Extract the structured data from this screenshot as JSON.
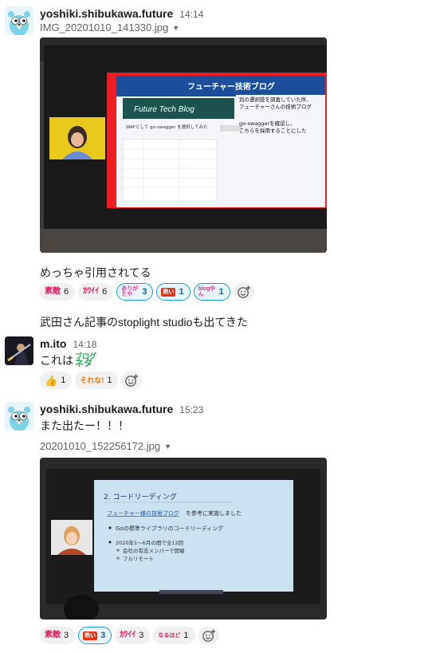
{
  "messages": [
    {
      "username": "yoshiki.shibukawa.future",
      "time": "14:14",
      "filename": "IMG_20201010_141330.jpg",
      "slide": {
        "title": "フューチャー技術ブログ",
        "banner": "Future Tech Blog",
        "heading": "WAFとして go-swagger を選択してみた",
        "annotation_1": "別の選択肢を調査していた所、\nフューチャーさんの技術ブログ",
        "annotation_2": "go-swaggerを確認し、\nこちらを採用することにした"
      },
      "text": "めっちゃ引用されてる",
      "reactions": [
        {
          "emoji": "素敵",
          "count": "6",
          "active": false,
          "color": "#d81e5b"
        },
        {
          "emoji": "ｶﾜｲｲ",
          "count": "6",
          "active": false,
          "color": "#d81e5b"
        },
        {
          "emoji": "ありがたや",
          "count": "3",
          "active": true,
          "color": "#e0459b"
        },
        {
          "emoji": "熱い",
          "count": "1",
          "active": true,
          "color": "#e63312"
        },
        {
          "emoji": "blogやん",
          "count": "1",
          "active": true,
          "color": "#c1398d"
        }
      ]
    },
    {
      "text": "武田さん記事のstoplight studioも出てきた"
    },
    {
      "username": "m.ito",
      "time": "14:18",
      "text": "これは",
      "inline_emoji_top": "ブログ",
      "inline_emoji_bottom": "ネタ",
      "reactions": [
        {
          "emoji": "thumbsup",
          "count": "1",
          "active": false,
          "color": "#f6b93b"
        },
        {
          "emoji": "それな!",
          "count": "1",
          "active": false,
          "color": "#e67e22"
        }
      ]
    },
    {
      "username": "yoshiki.shibukawa.future",
      "time": "15:23",
      "text": "また出たー！！！",
      "filename": "20201010_152256172.jpg",
      "slide": {
        "heading": "2. コードリーディング",
        "link": "フューチャー様の技術ブログ",
        "link_suffix": "を参考に実施しました",
        "bullet_1": "Goの標準ライブラリのコードリーディング",
        "bullet_2": "2020年1～6月の間で全12回",
        "sub_1": "会社の有志メンバーで開催",
        "sub_2": "フルリモート"
      },
      "reactions": [
        {
          "emoji": "素敵",
          "count": "3",
          "active": false,
          "color": "#d81e5b"
        },
        {
          "emoji": "熱い",
          "count": "3",
          "active": true,
          "color": "#e63312"
        },
        {
          "emoji": "ｶﾜｲｲ",
          "count": "3",
          "active": false,
          "color": "#d81e5b"
        },
        {
          "emoji": "なるほど",
          "count": "1",
          "active": false,
          "color": "#d81e5b"
        }
      ]
    }
  ],
  "colors": {
    "accent": "#1264a3",
    "active_reaction_border": "#1d9bd1",
    "reaction_bg": "#f1f1f1"
  }
}
